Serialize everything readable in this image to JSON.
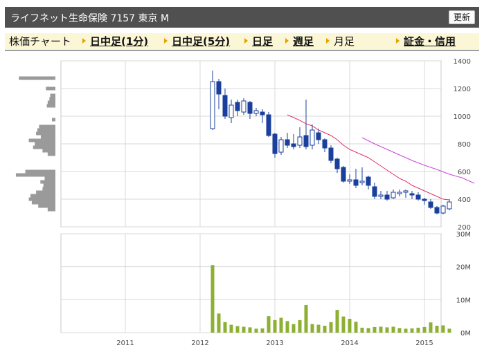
{
  "header": {
    "title": "ライフネット生命保険 7157 東京 M",
    "refresh_label": "更新"
  },
  "tabs": [
    {
      "label": "株価チャート",
      "link": false
    },
    {
      "label": "日中足(1分)",
      "link": true
    },
    {
      "label": "日中足(5分)",
      "link": true
    },
    {
      "label": "日足",
      "link": true
    },
    {
      "label": "週足",
      "link": true
    },
    {
      "label": "月足",
      "link": false
    },
    {
      "label": "証金・信用",
      "link": true
    }
  ],
  "colors": {
    "up": "#1a3f9c",
    "down": "#1a3f9c",
    "ma12": "#e0306a",
    "ma24": "#cc44dd",
    "volume": "#8db033",
    "profile": "#9a9a9a",
    "grid": "#d9d9d9"
  },
  "chart_data": [
    {
      "type": "candlestick",
      "title": "",
      "ylim": [
        200,
        1400
      ],
      "yticks": [
        "200",
        "400",
        "600",
        "800",
        "1000",
        "1200",
        "1400"
      ],
      "xticks": [
        "2011",
        "2012",
        "2013",
        "2014",
        "2015"
      ],
      "candles": [
        [
          "2012-03",
          910,
          1250,
          1330,
          900
        ],
        [
          "2012-04",
          1250,
          1160,
          1270,
          1050
        ],
        [
          "2012-05",
          1150,
          1000,
          1200,
          980
        ],
        [
          "2012-06",
          990,
          1080,
          1120,
          950
        ],
        [
          "2012-07",
          1100,
          1040,
          1120,
          1000
        ],
        [
          "2012-08",
          1030,
          1110,
          1130,
          1010
        ],
        [
          "2012-09",
          1100,
          1020,
          1110,
          980
        ],
        [
          "2012-10",
          1020,
          1040,
          1060,
          1000
        ],
        [
          "2012-11",
          1030,
          1010,
          1050,
          950
        ],
        [
          "2012-12",
          1010,
          860,
          1030,
          850
        ],
        [
          "2013-01",
          870,
          730,
          880,
          700
        ],
        [
          "2013-02",
          740,
          830,
          850,
          720
        ],
        [
          "2013-03",
          830,
          790,
          880,
          770
        ],
        [
          "2013-04",
          800,
          780,
          870,
          760
        ],
        [
          "2013-05",
          790,
          850,
          920,
          770
        ],
        [
          "2013-06",
          860,
          780,
          1120,
          760
        ],
        [
          "2013-07",
          790,
          900,
          940,
          760
        ],
        [
          "2013-08",
          880,
          830,
          910,
          800
        ],
        [
          "2013-09",
          830,
          770,
          840,
          740
        ],
        [
          "2013-10",
          770,
          680,
          790,
          660
        ],
        [
          "2013-11",
          690,
          620,
          700,
          590
        ],
        [
          "2013-12",
          630,
          530,
          640,
          520
        ],
        [
          "2014-01",
          530,
          540,
          580,
          510
        ],
        [
          "2014-02",
          540,
          500,
          620,
          480
        ],
        [
          "2014-03",
          520,
          530,
          630,
          500
        ],
        [
          "2014-04",
          560,
          500,
          570,
          470
        ],
        [
          "2014-05",
          490,
          420,
          520,
          400
        ],
        [
          "2014-06",
          420,
          430,
          460,
          400
        ],
        [
          "2014-07",
          430,
          400,
          460,
          390
        ],
        [
          "2014-08",
          410,
          450,
          470,
          400
        ],
        [
          "2014-09",
          440,
          450,
          470,
          420
        ],
        [
          "2014-10",
          450,
          460,
          470,
          410
        ],
        [
          "2014-11",
          440,
          430,
          460,
          400
        ],
        [
          "2014-12",
          430,
          400,
          450,
          390
        ],
        [
          "2015-01",
          400,
          390,
          410,
          360
        ],
        [
          "2015-02",
          380,
          340,
          400,
          330
        ],
        [
          "2015-03",
          340,
          300,
          350,
          290
        ],
        [
          "2015-04",
          300,
          350,
          360,
          290
        ],
        [
          "2015-05",
          330,
          380,
          400,
          320
        ]
      ],
      "series": [
        {
          "values": [
            [
              13.0,
              1010
            ],
            [
              14.0,
              990
            ],
            [
              15.0,
              970
            ],
            [
              16.0,
              945
            ],
            [
              17.0,
              930
            ],
            [
              18.0,
              900
            ],
            [
              19.0,
              880
            ],
            [
              20.0,
              860
            ],
            [
              21.0,
              830
            ],
            [
              22.0,
              790
            ],
            [
              23.0,
              760
            ],
            [
              24.0,
              740
            ],
            [
              25.0,
              720
            ],
            [
              26.0,
              700
            ],
            [
              27.0,
              670
            ],
            [
              28.0,
              640
            ],
            [
              29.0,
              610
            ],
            [
              30.0,
              580
            ],
            [
              31.0,
              550
            ],
            [
              32.0,
              530
            ],
            [
              33.0,
              500
            ],
            [
              34.0,
              480
            ],
            [
              35.0,
              460
            ],
            [
              36.0,
              440
            ],
            [
              37.0,
              420
            ],
            [
              38.0,
              400
            ],
            [
              39.0,
              395
            ]
          ]
        },
        {
          "values": [
            [
              25.0,
              845
            ],
            [
              27.0,
              800
            ],
            [
              29.0,
              760
            ],
            [
              31.0,
              720
            ],
            [
              33.0,
              680
            ],
            [
              35.0,
              645
            ],
            [
              37.0,
              615
            ],
            [
              39.0,
              580
            ],
            [
              41.0,
              555
            ],
            [
              43.0,
              515
            ]
          ]
        }
      ]
    },
    {
      "type": "bar",
      "title": "",
      "ylim": [
        0,
        30000000
      ],
      "yticks": [
        "0M",
        "10M",
        "20M",
        "30M"
      ],
      "xticks": [
        "2011",
        "2012",
        "2013",
        "2014",
        "2015"
      ],
      "categories": [
        "2012-03",
        "2012-04",
        "2012-05",
        "2012-06",
        "2012-07",
        "2012-08",
        "2012-09",
        "2012-10",
        "2012-11",
        "2012-12",
        "2013-01",
        "2013-02",
        "2013-03",
        "2013-04",
        "2013-05",
        "2013-06",
        "2013-07",
        "2013-08",
        "2013-09",
        "2013-10",
        "2013-11",
        "2013-12",
        "2014-01",
        "2014-02",
        "2014-03",
        "2014-04",
        "2014-05",
        "2014-06",
        "2014-07",
        "2014-08",
        "2014-09",
        "2014-10",
        "2014-11",
        "2014-12",
        "2015-01",
        "2015-02",
        "2015-03",
        "2015-04",
        "2015-05"
      ],
      "values": [
        20500000,
        5800000,
        3200000,
        2400000,
        2000000,
        1800000,
        1600000,
        1200000,
        1300000,
        5000000,
        3800000,
        4500000,
        3500000,
        2600000,
        3800000,
        8400000,
        2600000,
        2400000,
        2100000,
        3200000,
        6900000,
        4900000,
        4200000,
        3300000,
        1500000,
        1400000,
        1700000,
        1800000,
        1600000,
        1800000,
        1400000,
        1200000,
        1300000,
        1500000,
        1700000,
        3100000,
        2100000,
        2200000,
        1200000
      ]
    },
    {
      "type": "bar",
      "orientation": "horizontal",
      "title": "",
      "ylim": [
        200,
        1400
      ],
      "rows": [
        [
          1275,
          0.85
        ],
        [
          1200,
          0.22
        ],
        [
          1150,
          0.12
        ],
        [
          1125,
          0.14
        ],
        [
          1100,
          0.18
        ],
        [
          1075,
          0.2
        ],
        [
          975,
          0.08
        ],
        [
          925,
          0.38
        ],
        [
          900,
          0.42
        ],
        [
          875,
          0.45
        ],
        [
          850,
          0.34
        ],
        [
          825,
          0.62
        ],
        [
          800,
          0.48
        ],
        [
          775,
          0.52
        ],
        [
          750,
          0.3
        ],
        [
          725,
          0.18
        ],
        [
          600,
          0.7
        ],
        [
          575,
          0.92
        ],
        [
          550,
          0.25
        ],
        [
          525,
          0.35
        ],
        [
          500,
          0.28
        ],
        [
          475,
          0.3
        ],
        [
          450,
          0.45
        ],
        [
          425,
          0.58
        ],
        [
          400,
          0.62
        ],
        [
          375,
          0.55
        ],
        [
          350,
          0.4
        ],
        [
          325,
          0.18
        ]
      ]
    }
  ]
}
